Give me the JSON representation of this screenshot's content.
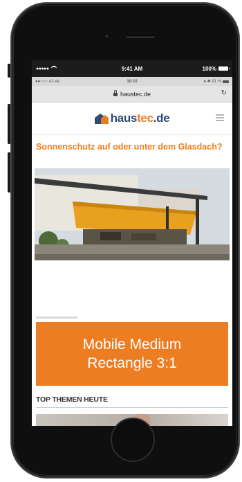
{
  "status_bar": {
    "carrier_dots": "●●●●●",
    "time": "9:41 AM",
    "battery": "100%",
    "icons": [
      "wifi-icon",
      "battery-icon"
    ]
  },
  "inner_status": {
    "carrier": "●●○○○ o2-de",
    "time": "10:10",
    "battery": "● ✱ 91 %"
  },
  "url_bar": {
    "url": "haustec.de",
    "icons": [
      "lock-icon",
      "reload-icon"
    ]
  },
  "site": {
    "logo_part1": "haus",
    "logo_part2": "tec",
    "logo_part3": ".de",
    "colors": {
      "brand_blue": "#2f4a74",
      "brand_orange": "#e87e23"
    }
  },
  "article": {
    "headline": "Sonnenschutz auf oder unter dem Glasdach?"
  },
  "ad": {
    "text_line1": "Mobile Medium",
    "text_line2": "Rectangle 3:1",
    "background": "#ec7d22"
  },
  "section": {
    "title": "TOP THEMEN HEUTE"
  }
}
